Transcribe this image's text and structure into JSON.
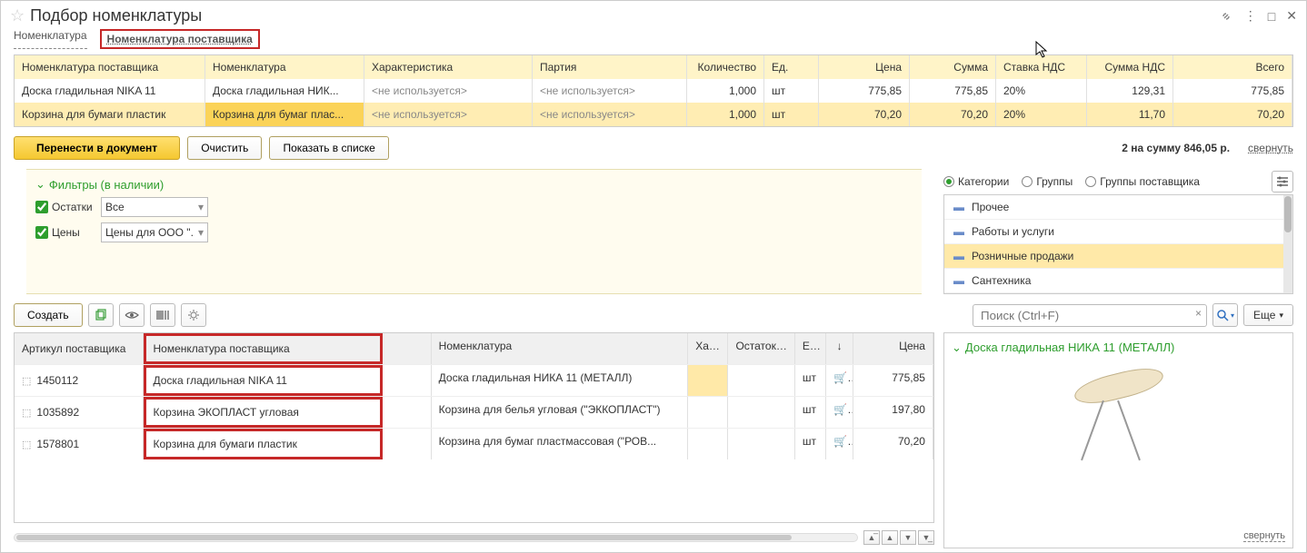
{
  "title": "Подбор номенклатуры",
  "tabs": {
    "nomenclature": "Номенклатура",
    "supplier": "Номенклатура поставщика"
  },
  "cart": {
    "headers": {
      "supplier": "Номенклатура поставщика",
      "nomenclature": "Номенклатура",
      "characteristic": "Характеристика",
      "party": "Партия",
      "quantity": "Количество",
      "unit": "Ед.",
      "price": "Цена",
      "sum": "Сумма",
      "vat_rate": "Ставка НДС",
      "vat_sum": "Сумма НДС",
      "total": "Всего"
    },
    "rows": [
      {
        "supplier": "Доска гладильная  NIKA 11",
        "nomenclature": "Доска гладильная  НИК...",
        "characteristic": "<не используется>",
        "party": "<не используется>",
        "quantity": "1,000",
        "unit": "шт",
        "price": "775,85",
        "sum": "775,85",
        "vat_rate": "20%",
        "vat_sum": "129,31",
        "total": "775,85"
      },
      {
        "supplier": "Корзина для бумаги пластик",
        "nomenclature": "Корзина для бумаг плас...",
        "characteristic": "<не используется>",
        "party": "<не используется>",
        "quantity": "1,000",
        "unit": "шт",
        "price": "70,20",
        "sum": "70,20",
        "vat_rate": "20%",
        "vat_sum": "11,70",
        "total": "70,20"
      }
    ]
  },
  "buttons": {
    "transfer": "Перенести в документ",
    "clear": "Очистить",
    "show_list": "Показать в списке",
    "create": "Создать",
    "more": "Еще"
  },
  "summary": "2 на сумму 846,05 р.",
  "collapse": "свернуть",
  "filters": {
    "title": "Фильтры (в наличии)",
    "balances_label": "Остатки",
    "balances_value": "Все",
    "prices_label": "Цены",
    "prices_value": "Цены для ООО \"."
  },
  "search": {
    "placeholder": "Поиск (Ctrl+F)"
  },
  "products": {
    "headers": {
      "article": "Артикул поставщика",
      "supplier": "Номенклатура поставщика",
      "nomenclature": "Номенклатура",
      "char": "Хар...",
      "remain": "Остаток ...",
      "unit": "Е...",
      "sort": "↓",
      "price": "Цена"
    },
    "rows": [
      {
        "article": "1450112",
        "supplier": "Доска гладильная  NIKA 11",
        "nomenclature": "Доска гладильная  НИКА 11 (МЕТАЛЛ)",
        "unit": "шт",
        "price": "775,85"
      },
      {
        "article": "1035892",
        "supplier": "Корзина ЭКОПЛАСТ угловая",
        "nomenclature": "Корзина для белья угловая (\"ЭККОПЛАСТ\")",
        "unit": "шт",
        "price": "197,80"
      },
      {
        "article": "1578801",
        "supplier": "Корзина для бумаги пластик",
        "nomenclature": "Корзина для бумаг пластмассовая (\"РОВ...",
        "unit": "шт",
        "price": "70,20"
      }
    ]
  },
  "view_modes": {
    "categories": "Категории",
    "groups": "Группы",
    "supplier_groups": "Группы поставщика"
  },
  "categories": [
    {
      "label": "Прочее"
    },
    {
      "label": "Работы и услуги"
    },
    {
      "label": "Розничные продажи"
    },
    {
      "label": "Сантехника"
    }
  ],
  "detail": {
    "title": "Доска гладильная  НИКА 11 (МЕТАЛЛ)"
  }
}
